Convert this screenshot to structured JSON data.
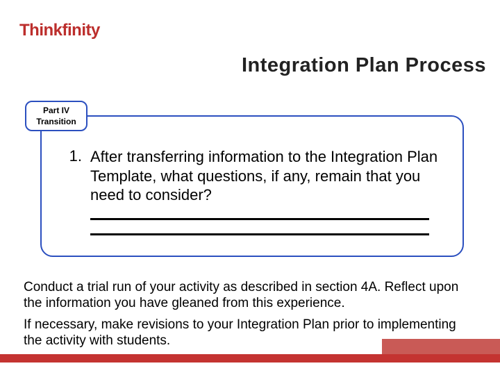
{
  "brand": {
    "name": "Thinkfinity"
  },
  "header": {
    "title": "Integration Plan Process"
  },
  "tab": {
    "line1": "Part IV",
    "line2": "Transition"
  },
  "question": {
    "number": "1.",
    "text": "After transferring information to the Integration Plan Template, what questions, if any, remain that you need to consider?"
  },
  "body": {
    "p1": "Conduct a trial run of your activity as described in section 4A. Reflect upon the information you have gleaned from this experience.",
    "p2": "If necessary, make revisions to your Integration Plan prior to implementing the activity with students."
  },
  "colors": {
    "brand_red": "#bc2e2c",
    "panel_blue": "#2b4fbf",
    "footer_red": "#c43331",
    "footer_accent": "#c95a56"
  }
}
